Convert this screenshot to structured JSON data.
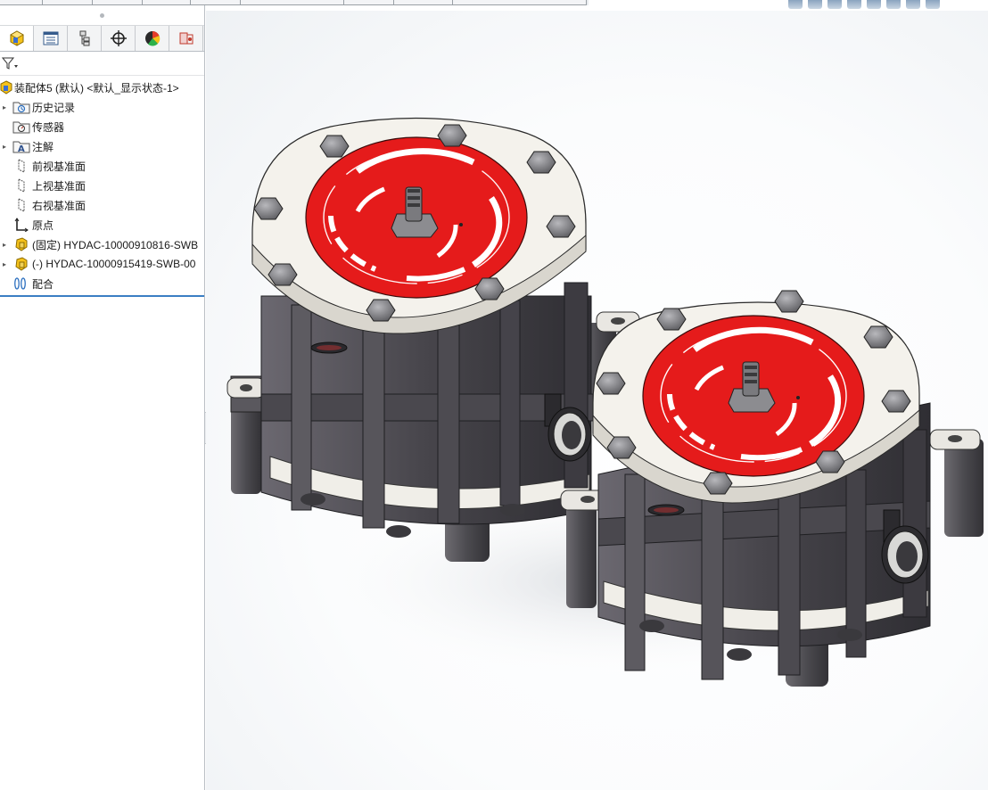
{
  "feature_tree": {
    "root": {
      "label": "装配体5 (默认) <默认_显示状态-1>"
    },
    "items": [
      {
        "label": "历史记录",
        "icon": "history-folder-icon",
        "expand": true
      },
      {
        "label": "传感器",
        "icon": "sensor-folder-icon",
        "expand": false
      },
      {
        "label": "注解",
        "icon": "annotation-icon",
        "expand": true
      },
      {
        "label": "前视基准面",
        "icon": "plane-icon",
        "expand": false
      },
      {
        "label": "上视基准面",
        "icon": "plane-icon",
        "expand": false
      },
      {
        "label": "右视基准面",
        "icon": "plane-icon",
        "expand": false
      },
      {
        "label": "原点",
        "icon": "origin-icon",
        "expand": false
      },
      {
        "label": "(固定) HYDAC-10000910816-SWB",
        "icon": "subassembly-icon",
        "expand": true
      },
      {
        "label": "(-) HYDAC-10000915419-SWB-00",
        "icon": "subassembly-icon",
        "expand": true
      },
      {
        "label": "配合",
        "icon": "mates-icon",
        "expand": false
      }
    ]
  },
  "panel_tabs": [
    "feature-manager",
    "property-manager",
    "configuration-manager",
    "dimxpert-manager",
    "display-manager",
    "cam-manager"
  ],
  "colors": {
    "accent_blue": "#3b7fc4",
    "part_red": "#e51b1b",
    "cap_white": "#f2f0ea",
    "body_gray": "#4e4c52"
  }
}
